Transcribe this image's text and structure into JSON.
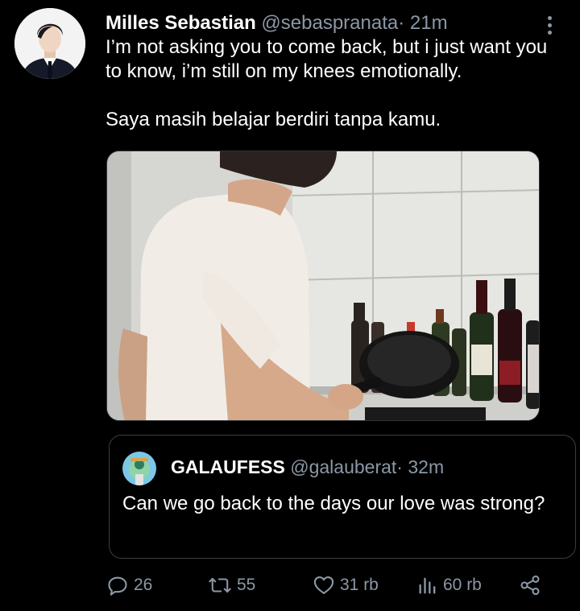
{
  "tweet": {
    "display_name": "Milles Sebastian",
    "handle": "@sebaspranata",
    "separator": "·",
    "time": "21m",
    "text_line1": "I’m not asking you to come back, but i just want you to know, i’m still on my knees emotionally.",
    "text_line2": "Saya masih belajar berdiri tanpa kamu."
  },
  "quote": {
    "display_name": "GALAUFESS",
    "handle": "@galauberat",
    "separator": "·",
    "time": "32m",
    "text": "Can we go back to the days our love was strong?"
  },
  "actions": {
    "replies": "26",
    "retweets": "55",
    "likes": "31 rb",
    "views": "60 rb"
  },
  "icons": [
    "more-icon",
    "reply-icon",
    "retweet-icon",
    "like-icon",
    "views-icon",
    "share-icon"
  ],
  "colors": {
    "background": "#000000",
    "primary_text": "#ffffff",
    "secondary_text": "#8b98a5",
    "border": "#3a3d40"
  }
}
